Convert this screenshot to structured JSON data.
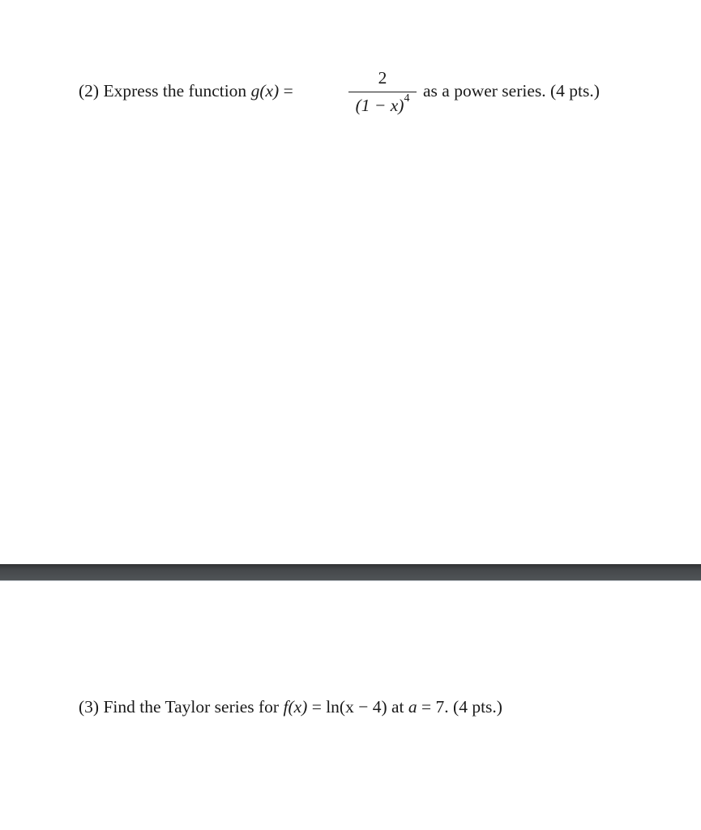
{
  "question2": {
    "prefix": "(2) Express the function ",
    "func": "g(x)",
    "equals": " = ",
    "fraction": {
      "numerator": "2",
      "denominator_base": "(1 − x)",
      "denominator_exponent": "4"
    },
    "suffix": "as a power series. (4 pts.)"
  },
  "separator": {
    "color": "#45484b"
  },
  "question3": {
    "prefix": "(3) Find the Taylor series for ",
    "func": "f(x)",
    "equals": " = ",
    "expression": "ln(x − 4)",
    "at": " at ",
    "point_var": "a",
    "point_value": " = 7. ",
    "points": "(4 pts.)"
  }
}
